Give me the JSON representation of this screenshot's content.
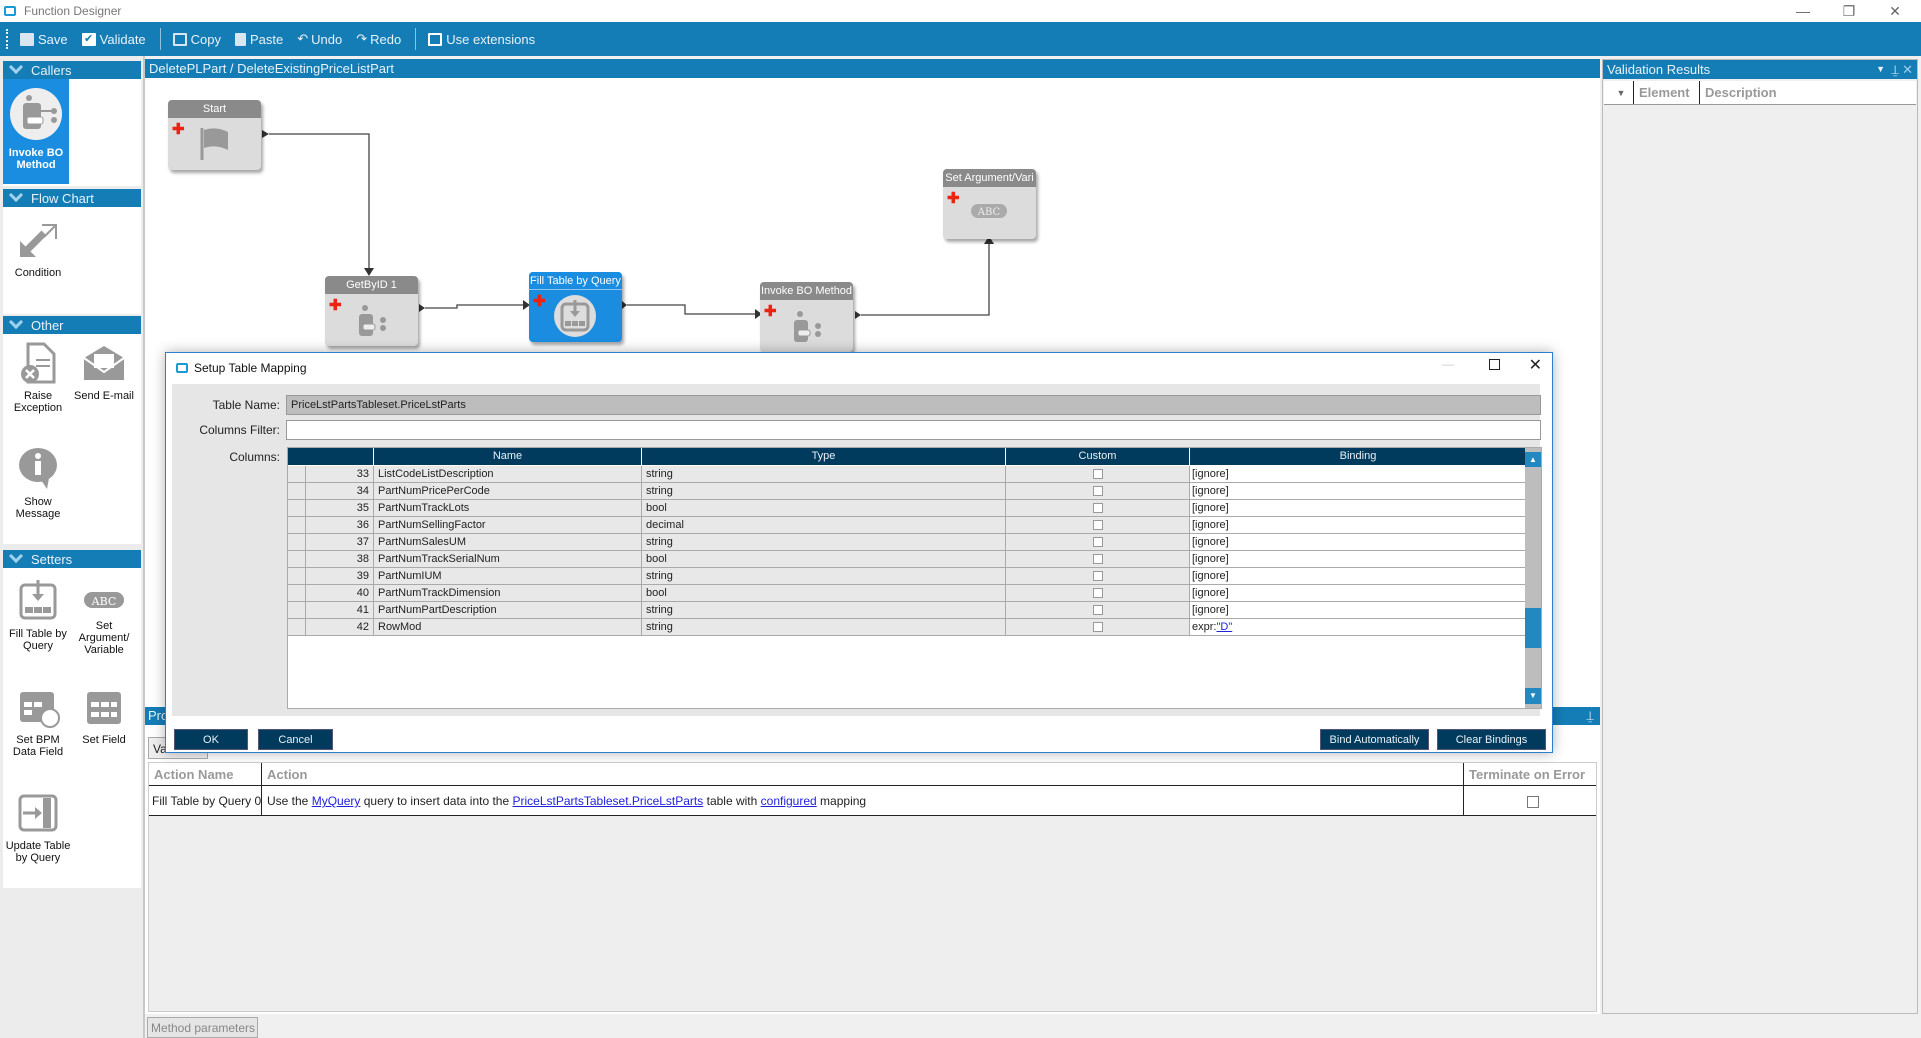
{
  "window": {
    "title": "Function Designer"
  },
  "toolbar": {
    "save": "Save",
    "validate": "Validate",
    "copy": "Copy",
    "paste": "Paste",
    "undo": "Undo",
    "redo": "Redo",
    "use_extensions": "Use extensions"
  },
  "sidebar": {
    "callers": {
      "title": "Callers",
      "items": [
        {
          "label": "Invoke BO Method",
          "icon": "invoke-bo-method-icon",
          "selected": true
        }
      ]
    },
    "flowchart": {
      "title": "Flow Chart",
      "items": [
        {
          "label": "Condition",
          "icon": "condition-icon"
        }
      ]
    },
    "other": {
      "title": "Other",
      "items": [
        {
          "label": "Raise Exception",
          "icon": "raise-exception-icon"
        },
        {
          "label": "Send E-mail",
          "icon": "envelope-icon"
        },
        {
          "label": "Show Message",
          "icon": "info-bubble-icon"
        }
      ]
    },
    "setters": {
      "title": "Setters",
      "items": [
        {
          "label": "Fill Table by Query",
          "icon": "fill-table-icon"
        },
        {
          "label": "Set Argument/ Variable",
          "icon": "abc-icon"
        },
        {
          "label": "Set BPM Data Field",
          "icon": "calendar-cube-icon"
        },
        {
          "label": "Set Field",
          "icon": "calendar-icon"
        },
        {
          "label": "Update Table by Query",
          "icon": "update-table-icon"
        }
      ]
    }
  },
  "canvas": {
    "breadcrumb": "DeletePLPart / DeleteExistingPriceListPart",
    "nodes": [
      {
        "label": "Start",
        "icon": "flag-icon"
      },
      {
        "label": "GetByID 1",
        "icon": "invoke-bo-method-icon"
      },
      {
        "label": "Fill Table by Query",
        "icon": "fill-table-icon",
        "active": true
      },
      {
        "label": "Invoke BO Method",
        "icon": "invoke-bo-method-icon"
      },
      {
        "label": "Set Argument/Vari",
        "icon": "abc-icon"
      }
    ]
  },
  "validation": {
    "title": "Validation Results",
    "columns": [
      "Element",
      "Description"
    ]
  },
  "properties": {
    "title": "Pro",
    "tab": "Va",
    "columns": [
      "Action Name",
      "Action",
      "Terminate on Error"
    ],
    "row": {
      "name": "Fill Table by Query 0",
      "t1": "Use the",
      "link1": "MyQuery",
      "t2": "query to insert data into the",
      "link2": "PriceLstPartsTableset.PriceLstParts",
      "t3": "table with",
      "link3": "configured",
      "t4": "mapping",
      "terminate": false
    },
    "bottom_tab": "Method parameters"
  },
  "dialog": {
    "title": "Setup Table Mapping",
    "table_name_label": "Table Name:",
    "table_name": "PriceLstPartsTableset.PriceLstParts",
    "filter_label": "Columns Filter:",
    "filter_value": "",
    "columns_label": "Columns:",
    "grid_headers": [
      "Name",
      "Type",
      "Custom",
      "Binding"
    ],
    "rows": [
      {
        "n": "33",
        "name": "ListCodeListDescription",
        "type": "string",
        "custom": false,
        "binding": "[ignore]"
      },
      {
        "n": "34",
        "name": "PartNumPricePerCode",
        "type": "string",
        "custom": false,
        "binding": "[ignore]"
      },
      {
        "n": "35",
        "name": "PartNumTrackLots",
        "type": "bool",
        "custom": false,
        "binding": "[ignore]"
      },
      {
        "n": "36",
        "name": "PartNumSellingFactor",
        "type": "decimal",
        "custom": false,
        "binding": "[ignore]"
      },
      {
        "n": "37",
        "name": "PartNumSalesUM",
        "type": "string",
        "custom": false,
        "binding": "[ignore]"
      },
      {
        "n": "38",
        "name": "PartNumTrackSerialNum",
        "type": "bool",
        "custom": false,
        "binding": "[ignore]"
      },
      {
        "n": "39",
        "name": "PartNumIUM",
        "type": "string",
        "custom": false,
        "binding": "[ignore]"
      },
      {
        "n": "40",
        "name": "PartNumTrackDimension",
        "type": "bool",
        "custom": false,
        "binding": "[ignore]"
      },
      {
        "n": "41",
        "name": "PartNumPartDescription",
        "type": "string",
        "custom": false,
        "binding": "[ignore]"
      },
      {
        "n": "42",
        "name": "RowMod",
        "type": "string",
        "custom": false,
        "binding": "expr:",
        "binding_link": "\"D\""
      }
    ],
    "ok": "OK",
    "cancel": "Cancel",
    "bind_auto": "Bind Automatically",
    "clear": "Clear Bindings"
  },
  "colors": {
    "accent": "#147db6",
    "dialog_header": "#003a5c",
    "selected": "#1a8de0"
  }
}
